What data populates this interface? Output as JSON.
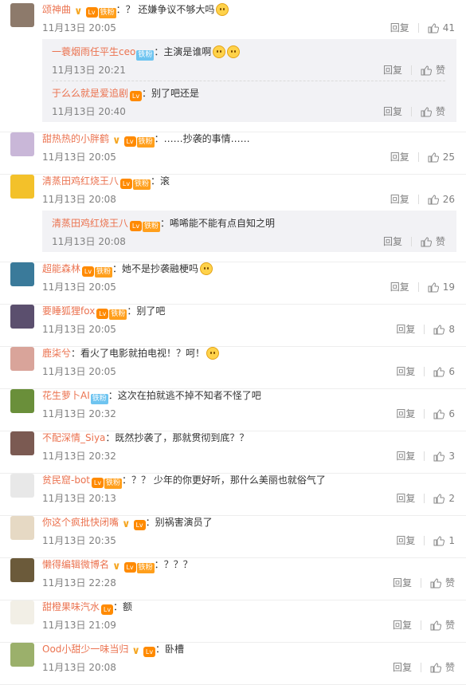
{
  "labels": {
    "reply": "回复",
    "like_zero": "赞"
  },
  "comments": [
    {
      "user": "颂神曲",
      "v": true,
      "lv": "Lv",
      "fan": "铁粉",
      "fan_color": "orange",
      "text": "：？ 还嫌争议不够大吗",
      "emoji": "wink-face",
      "time": "11月13日 20:05",
      "likes": "41",
      "avatar_color": "#8d7a6b",
      "replies": [
        {
          "user": "一蓑烟雨任平生ceo",
          "v": false,
          "lv": "",
          "fan": "铁粉",
          "fan_color": "blue",
          "text": "：主演是谁啊",
          "emoji": "thinking-face-x2",
          "time": "11月13日 20:21",
          "likes": "赞"
        },
        {
          "user": "于么么就是爱追剧",
          "v": false,
          "lv": "Lv",
          "fan": "",
          "fan_color": "",
          "text": "：别了吧还是",
          "emoji": "",
          "time": "11月13日 20:40",
          "likes": "赞"
        }
      ]
    },
    {
      "user": "甜热热的小胖鹤",
      "v": true,
      "lv": "Lv",
      "fan": "铁粉",
      "fan_color": "orange",
      "text": "：……抄袭的事情……",
      "emoji": "",
      "time": "11月13日 20:05",
      "likes": "25",
      "avatar_color": "#c9b7d8",
      "replies": []
    },
    {
      "user": "清蒸田鸡红烧王八",
      "v": false,
      "lv": "Lv",
      "fan": "铁粉",
      "fan_color": "orange",
      "text": "：滚",
      "emoji": "",
      "time": "11月13日 20:08",
      "likes": "26",
      "avatar_color": "#f3c12a",
      "replies": [
        {
          "user": "清蒸田鸡红烧王八",
          "v": false,
          "lv": "Lv",
          "fan": "铁粉",
          "fan_color": "orange",
          "text": "：唏唏能不能有点自知之明",
          "emoji": "",
          "time": "11月13日 20:08",
          "likes": "赞"
        }
      ]
    },
    {
      "user": "超能森林",
      "v": false,
      "lv": "Lv",
      "fan": "铁粉",
      "fan_color": "orange",
      "text": "：她不是抄袭融梗吗",
      "emoji": "smirk-face",
      "time": "11月13日 20:05",
      "likes": "19",
      "avatar_color": "#3a7a9a",
      "replies": []
    },
    {
      "user": "要睡狐狸fox",
      "v": false,
      "lv": "Lv",
      "fan": "铁粉",
      "fan_color": "orange",
      "text": "：别了吧",
      "emoji": "",
      "time": "11月13日 20:05",
      "likes": "8",
      "avatar_color": "#5b4f6e",
      "replies": []
    },
    {
      "user": "鹿柒兮",
      "v": false,
      "lv": "",
      "fan": "",
      "fan_color": "",
      "text": "：看火了电影就拍电视！？呵！",
      "emoji": "doge-face",
      "time": "11月13日 20:05",
      "likes": "6",
      "avatar_color": "#d9a49a",
      "replies": []
    },
    {
      "user": "花生萝卜AI",
      "v": false,
      "lv": "",
      "fan": "铁粉",
      "fan_color": "blue",
      "text": "：这次在拍就逃不掉不知者不怪了吧",
      "emoji": "",
      "time": "11月13日 20:32",
      "likes": "6",
      "avatar_color": "#6a8f3a",
      "replies": []
    },
    {
      "user": "不配深情_Siya",
      "v": false,
      "lv": "",
      "fan": "",
      "fan_color": "",
      "text": "：既然抄袭了，那就贯彻到底？？",
      "emoji": "",
      "time": "11月13日 20:32",
      "likes": "3",
      "avatar_color": "#7b5a52",
      "replies": []
    },
    {
      "user": "贫民窟-bot",
      "v": false,
      "lv": "Lv",
      "fan": "铁粉",
      "fan_color": "orange",
      "text": "：？？ 少年的你更好听，那什么美丽也就俗气了",
      "emoji": "",
      "time": "11月13日 20:13",
      "likes": "2",
      "avatar_color": "#e8e8e8",
      "replies": []
    },
    {
      "user": "你这个疯批快闭嘴",
      "v": true,
      "lv": "Lv",
      "fan": "",
      "fan_color": "",
      "text": "：别祸害演员了",
      "emoji": "",
      "time": "11月13日 20:35",
      "likes": "1",
      "avatar_color": "#e6d9c4",
      "replies": []
    },
    {
      "user": "懒得编辑微博名",
      "v": true,
      "lv": "Lv",
      "fan": "铁粉",
      "fan_color": "orange",
      "text": "：？？？",
      "emoji": "",
      "time": "11月13日 22:28",
      "likes": "赞",
      "avatar_color": "#6b5a3a",
      "replies": []
    },
    {
      "user": "甜橙果味汽水",
      "v": false,
      "lv": "Lv",
      "fan": "",
      "fan_color": "",
      "text": "：额",
      "emoji": "",
      "time": "11月13日 21:09",
      "likes": "赞",
      "avatar_color": "#f2efe6",
      "replies": []
    },
    {
      "user": "Ood小甜少一味当归",
      "v": true,
      "lv": "Lv",
      "fan": "",
      "fan_color": "",
      "text": "：卧槽",
      "emoji": "",
      "time": "11月13日 20:08",
      "likes": "赞",
      "avatar_color": "#9bb06b",
      "replies": []
    }
  ]
}
